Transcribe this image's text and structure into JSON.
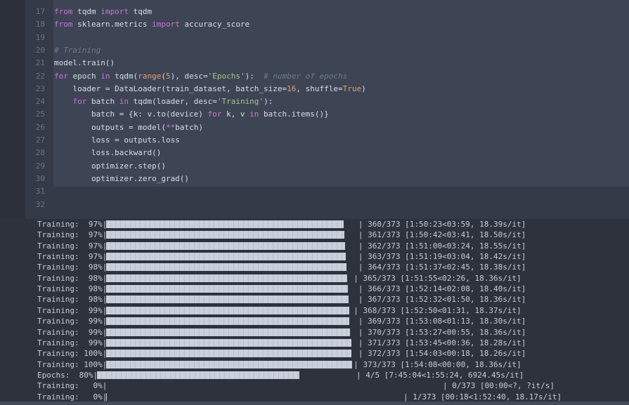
{
  "editor": {
    "lines": [
      {
        "num": "17",
        "html": "<span class='kw'>from</span> tqdm <span class='kw'>import</span> tqdm"
      },
      {
        "num": "18",
        "html": "<span class='kw'>from</span> sklearn.metrics <span class='kw'>import</span> accuracy_score"
      },
      {
        "num": "19",
        "html": ""
      },
      {
        "num": "20",
        "html": "<span class='cmt'># Training</span>"
      },
      {
        "num": "21",
        "html": "model.train()"
      },
      {
        "num": "22",
        "html": "<span class='kw'>for</span> epoch <span class='kw'>in</span> tqdm(<span class='bi'>range</span>(<span class='num'>5</span>), desc=<span class='str'>'Epochs'</span>):  <span class='cmt'># number of epochs</span>"
      },
      {
        "num": "23",
        "html": "    loader = DataLoader(train_dataset, batch_size=<span class='num'>16</span>, shuffle=<span class='num'>True</span>)"
      },
      {
        "num": "24",
        "html": "    <span class='kw'>for</span> batch <span class='kw'>in</span> tqdm(loader, desc=<span class='str'>'Training'</span>):"
      },
      {
        "num": "25",
        "html": "        batch = {k: v.to(device) <span class='kw'>for</span> k, v <span class='kw'>in</span> batch.items()}"
      },
      {
        "num": "26",
        "html": "        outputs = model(<span class='op'>**</span>batch)"
      },
      {
        "num": "27",
        "html": "        loss = outputs.loss"
      },
      {
        "num": "28",
        "html": "        loss.backward()"
      },
      {
        "num": "29",
        "html": "        optimizer.step()"
      },
      {
        "num": "30",
        "html": "        optimizer.zero_grad()"
      },
      {
        "num": "31",
        "html": ""
      },
      {
        "num": "32",
        "html": ""
      }
    ]
  },
  "output": {
    "rows": [
      {
        "label": "Training:  97%|",
        "progress": 0.965,
        "stat": " | 360/373 [1:50:23<03:59, 18.39s/it]"
      },
      {
        "label": "Training:  97%|",
        "progress": 0.968,
        "stat": " | 361/373 [1:50:42<03:41, 18.50s/it]"
      },
      {
        "label": "Training:  97%|",
        "progress": 0.971,
        "stat": " | 362/373 [1:51:00<03:24, 18.55s/it]"
      },
      {
        "label": "Training:  97%|",
        "progress": 0.973,
        "stat": " | 363/373 [1:51:19<03:04, 18.42s/it]"
      },
      {
        "label": "Training:  98%|",
        "progress": 0.976,
        "stat": " | 364/373 [1:51:37<02:45, 18.38s/it]"
      },
      {
        "label": "Training:  98%|",
        "progress": 0.979,
        "stat": "| 365/373 [1:51:55<02:26, 18.36s/it]"
      },
      {
        "label": "Training:  98%|",
        "progress": 0.981,
        "stat": " | 366/373 [1:52:14<02:08, 18.40s/it]"
      },
      {
        "label": "Training:  98%|",
        "progress": 0.984,
        "stat": " | 367/373 [1:52:32<01:50, 18.36s/it]"
      },
      {
        "label": "Training:  99%|",
        "progress": 0.987,
        "stat": "| 368/373 [1:52:50<01:31, 18.37s/it]"
      },
      {
        "label": "Training:  99%|",
        "progress": 0.989,
        "stat": " | 369/373 [1:53:08<01:13, 18.30s/it]"
      },
      {
        "label": "Training:  99%|",
        "progress": 0.992,
        "stat": " | 370/373 [1:53:27<00:55, 18.36s/it]"
      },
      {
        "label": "Training:  99%|",
        "progress": 0.995,
        "stat": " | 371/373 [1:53:45<00:36, 18.28s/it]"
      },
      {
        "label": "Training: 100%|",
        "progress": 0.997,
        "stat": " | 372/373 [1:54:03<00:18, 18.26s/it]"
      },
      {
        "label": "Training: 100%|",
        "progress": 1.0,
        "stat": "| 373/373 [1:54:08<00:00, 18.36s/it]"
      },
      {
        "label": "Epochs:  80%|",
        "progress": 0.8,
        "stat": "| 4/5 [7:45:04<1:55:24, 6924.45s/it]"
      },
      {
        "label": "Training:   0%|",
        "progress": 0.0,
        "stat": "| 0/373 [00:00<?, ?it/s]"
      },
      {
        "label": "Training:   0%|",
        "progress": 0.003,
        "stat": "| 1/373 [00:18<1:52:40, 18.17s/it]"
      }
    ]
  }
}
